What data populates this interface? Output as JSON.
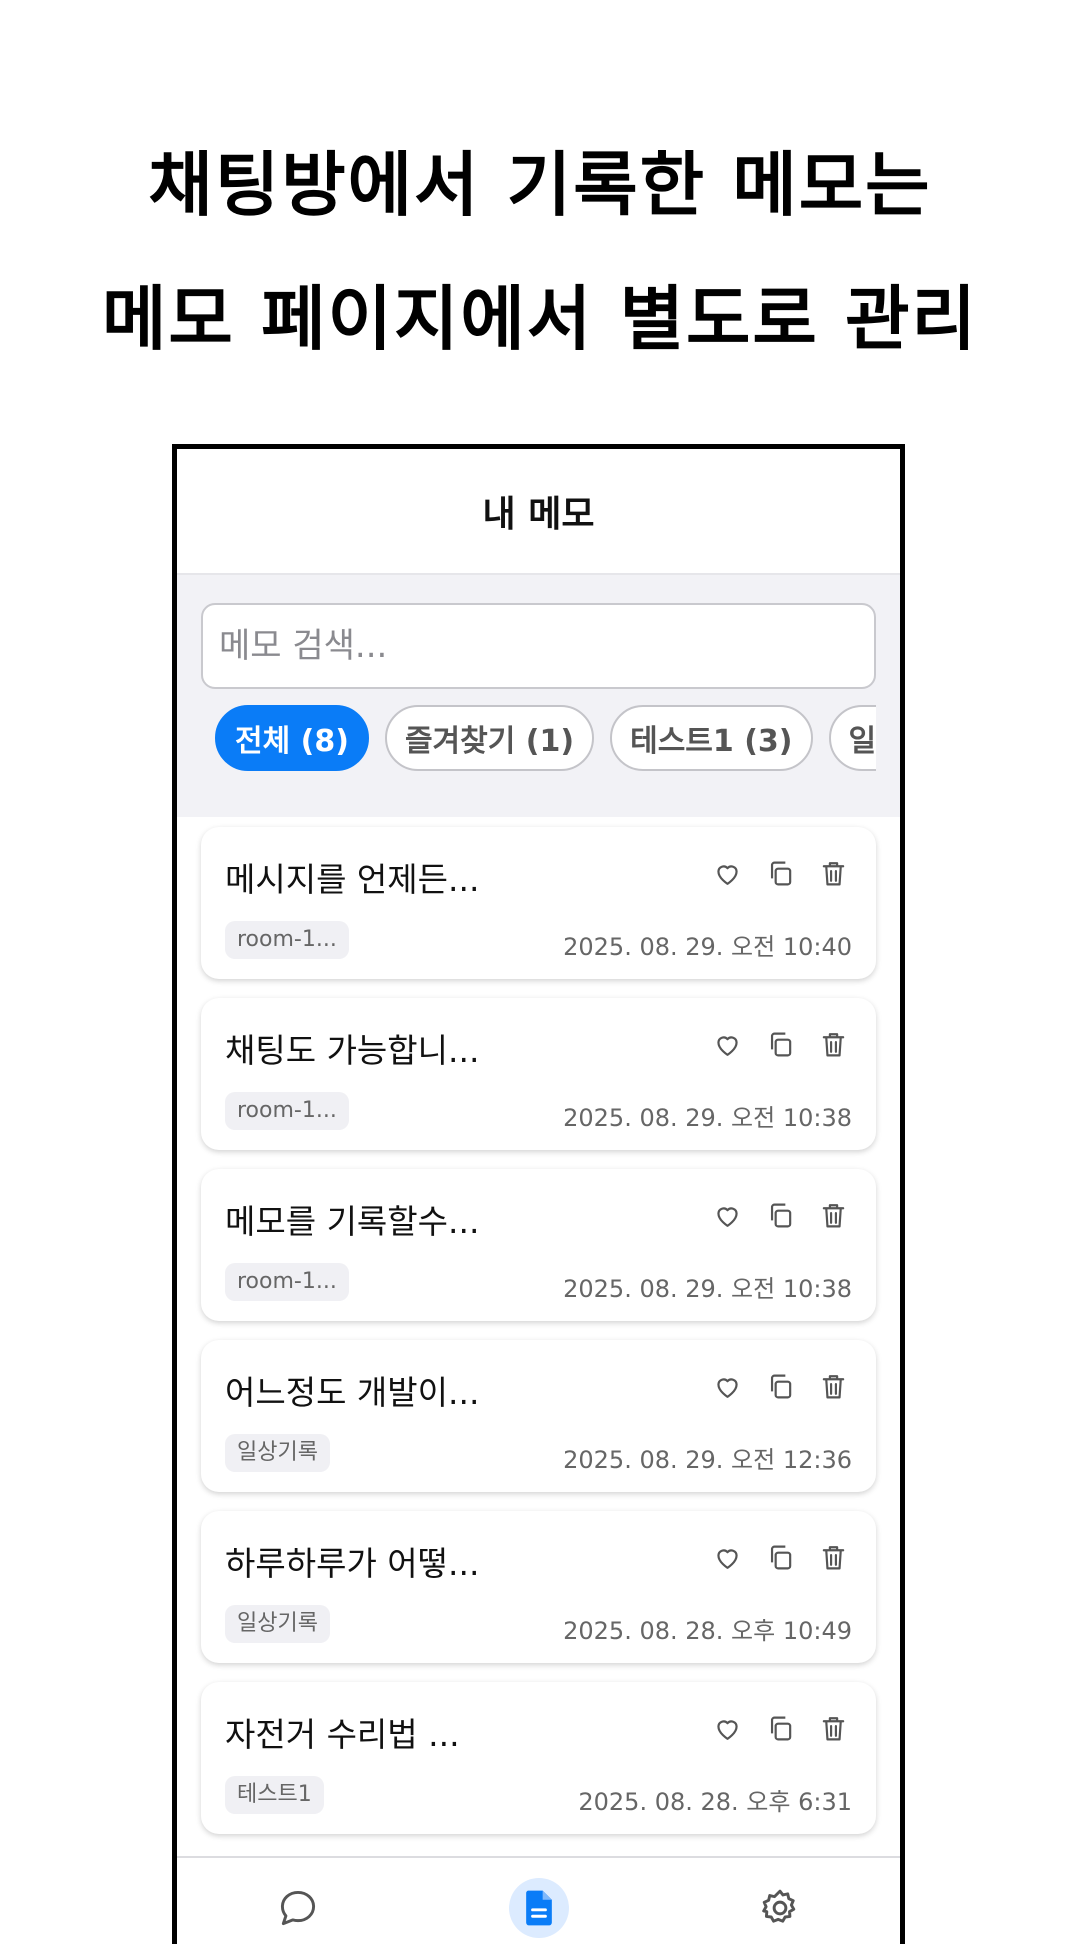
{
  "headline": {
    "line1": "채팅방에서 기록한 메모는",
    "line2": "메모 페이지에서 별도로 관리"
  },
  "app": {
    "title": "내 메모"
  },
  "search": {
    "placeholder": "메모 검색..."
  },
  "filters": [
    {
      "label": "전체 (8)",
      "active": true
    },
    {
      "label": "즐겨찾기 (1)",
      "active": false
    },
    {
      "label": "테스트1 (3)",
      "active": false
    },
    {
      "label": "일상기",
      "active": false
    }
  ],
  "memos": [
    {
      "title": "메시지를 언제든...",
      "tag": "room-1...",
      "date": "2025. 08. 29. 오전 10:40"
    },
    {
      "title": "채팅도 가능합니...",
      "tag": "room-1...",
      "date": "2025. 08. 29. 오전 10:38"
    },
    {
      "title": "메모를 기록할수...",
      "tag": "room-1...",
      "date": "2025. 08. 29. 오전 10:38"
    },
    {
      "title": "어느정도 개발이...",
      "tag": "일상기록",
      "date": "2025. 08. 29. 오전 12:36"
    },
    {
      "title": "하루하루가 어떻...",
      "tag": "일상기록",
      "date": "2025. 08. 28. 오후 10:49"
    },
    {
      "title": "자전거 수리법 ...",
      "tag": "테스트1",
      "date": "2025. 08. 28. 오후 6:31"
    }
  ],
  "nav": [
    {
      "icon": "chat-icon",
      "active": false
    },
    {
      "icon": "memo-icon",
      "active": true
    },
    {
      "icon": "gear-icon",
      "active": false
    }
  ],
  "colors": {
    "accent": "#0a7cf7",
    "nav_active_bg": "#dcebff"
  }
}
